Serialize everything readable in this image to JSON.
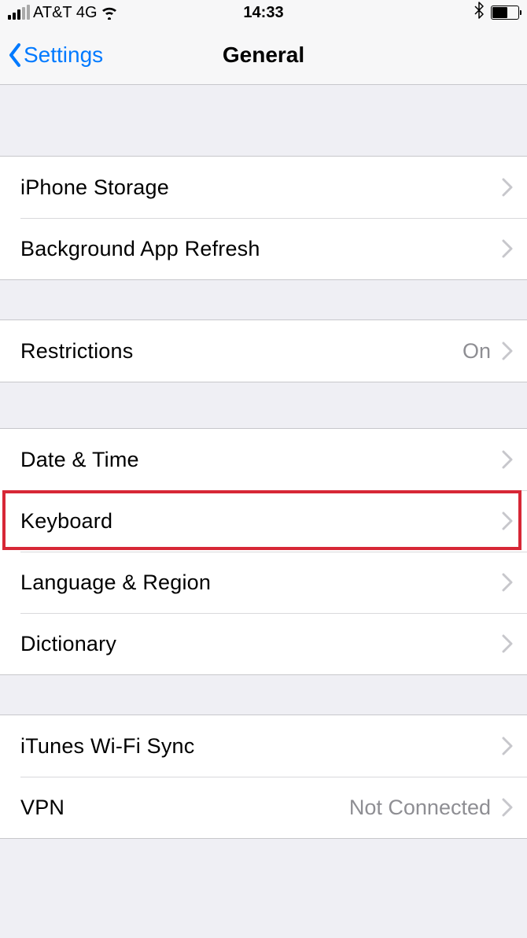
{
  "statusBar": {
    "carrier": "AT&T 4G",
    "time": "14:33"
  },
  "nav": {
    "back": "Settings",
    "title": "General"
  },
  "groups": [
    {
      "rows": [
        {
          "label": "iPhone Storage",
          "value": ""
        },
        {
          "label": "Background App Refresh",
          "value": ""
        }
      ]
    },
    {
      "rows": [
        {
          "label": "Restrictions",
          "value": "On"
        }
      ]
    },
    {
      "rows": [
        {
          "label": "Date & Time",
          "value": ""
        },
        {
          "label": "Keyboard",
          "value": ""
        },
        {
          "label": "Language & Region",
          "value": ""
        },
        {
          "label": "Dictionary",
          "value": ""
        }
      ]
    },
    {
      "rows": [
        {
          "label": "iTunes Wi-Fi Sync",
          "value": ""
        },
        {
          "label": "VPN",
          "value": "Not Connected"
        }
      ]
    }
  ],
  "highlightedRow": "Keyboard"
}
